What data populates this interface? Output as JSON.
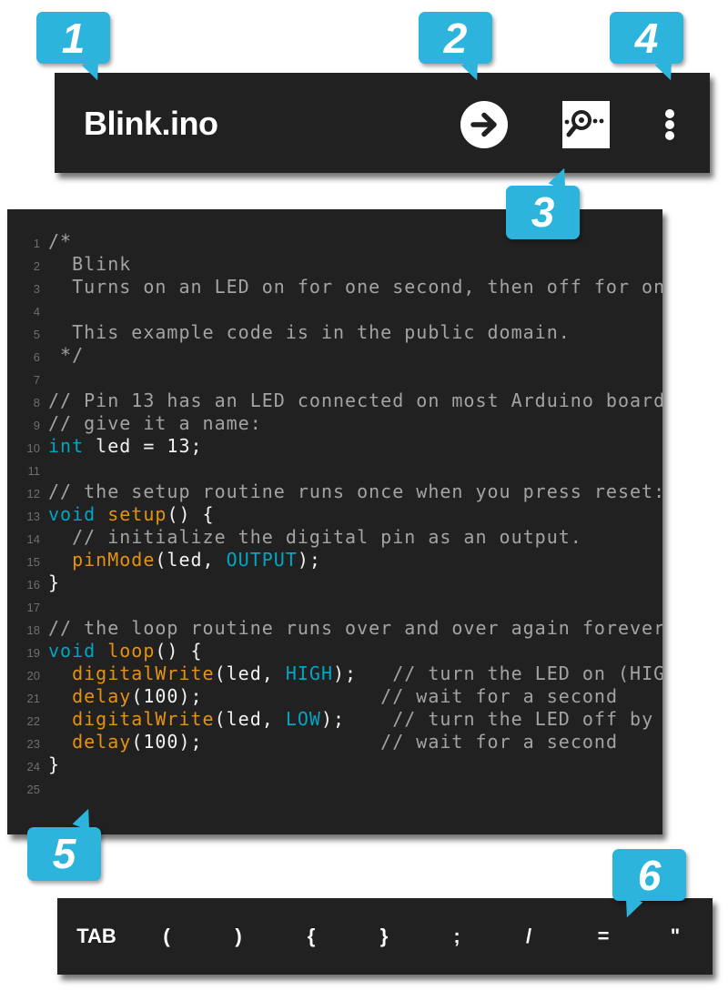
{
  "app_bar": {
    "title": "Blink.ino",
    "upload_icon": "arrow-right-circle-icon",
    "serial_monitor_icon": "serial-monitor-magnifier-icon",
    "overflow_icon": "more-vert-icon"
  },
  "editor": {
    "lines": [
      {
        "num": "1",
        "tokens": [
          {
            "t": "/*",
            "c": "comment"
          }
        ]
      },
      {
        "num": "2",
        "tokens": [
          {
            "t": "  Blink",
            "c": "comment"
          }
        ]
      },
      {
        "num": "3",
        "tokens": [
          {
            "t": "  Turns on an LED on for one second, then off for on",
            "c": "comment"
          }
        ]
      },
      {
        "num": "4",
        "tokens": []
      },
      {
        "num": "5",
        "tokens": [
          {
            "t": "  This example code is in the public domain.",
            "c": "comment"
          }
        ]
      },
      {
        "num": "6",
        "tokens": [
          {
            "t": " */",
            "c": "comment"
          }
        ]
      },
      {
        "num": "7",
        "tokens": []
      },
      {
        "num": "8",
        "tokens": [
          {
            "t": "// Pin 13 has an LED connected on most Arduino board",
            "c": "comment"
          }
        ]
      },
      {
        "num": "9",
        "tokens": [
          {
            "t": "// give it a name:",
            "c": "comment"
          }
        ]
      },
      {
        "num": "10",
        "tokens": [
          {
            "t": "int",
            "c": "type"
          },
          {
            "t": " led = 13;",
            "c": "plain"
          }
        ]
      },
      {
        "num": "11",
        "tokens": []
      },
      {
        "num": "12",
        "tokens": [
          {
            "t": "// the setup routine runs once when you press reset:",
            "c": "comment"
          }
        ]
      },
      {
        "num": "13",
        "tokens": [
          {
            "t": "void",
            "c": "type"
          },
          {
            "t": " ",
            "c": "plain"
          },
          {
            "t": "setup",
            "c": "func"
          },
          {
            "t": "() {",
            "c": "plain"
          }
        ]
      },
      {
        "num": "14",
        "tokens": [
          {
            "t": "  // initialize the digital pin as an output.",
            "c": "comment"
          }
        ]
      },
      {
        "num": "15",
        "tokens": [
          {
            "t": "  ",
            "c": "plain"
          },
          {
            "t": "pinMode",
            "c": "func"
          },
          {
            "t": "(led, ",
            "c": "plain"
          },
          {
            "t": "OUTPUT",
            "c": "const"
          },
          {
            "t": ");",
            "c": "plain"
          }
        ]
      },
      {
        "num": "16",
        "tokens": [
          {
            "t": "}",
            "c": "plain"
          }
        ]
      },
      {
        "num": "17",
        "tokens": []
      },
      {
        "num": "18",
        "tokens": [
          {
            "t": "// the loop routine runs over and over again forever",
            "c": "comment"
          }
        ]
      },
      {
        "num": "19",
        "tokens": [
          {
            "t": "void",
            "c": "type"
          },
          {
            "t": " ",
            "c": "plain"
          },
          {
            "t": "loop",
            "c": "func"
          },
          {
            "t": "() {",
            "c": "plain"
          }
        ]
      },
      {
        "num": "20",
        "tokens": [
          {
            "t": "  ",
            "c": "plain"
          },
          {
            "t": "digitalWrite",
            "c": "func"
          },
          {
            "t": "(led, ",
            "c": "plain"
          },
          {
            "t": "HIGH",
            "c": "const"
          },
          {
            "t": ");",
            "c": "plain"
          },
          {
            "t": "   // turn the LED on (HIG",
            "c": "comment"
          }
        ]
      },
      {
        "num": "21",
        "tokens": [
          {
            "t": "  ",
            "c": "plain"
          },
          {
            "t": "delay",
            "c": "func"
          },
          {
            "t": "(100);",
            "c": "plain"
          },
          {
            "t": "               // wait for a second",
            "c": "comment"
          }
        ]
      },
      {
        "num": "22",
        "tokens": [
          {
            "t": "  ",
            "c": "plain"
          },
          {
            "t": "digitalWrite",
            "c": "func"
          },
          {
            "t": "(led, ",
            "c": "plain"
          },
          {
            "t": "LOW",
            "c": "const"
          },
          {
            "t": ");",
            "c": "plain"
          },
          {
            "t": "    // turn the LED off by",
            "c": "comment"
          }
        ]
      },
      {
        "num": "23",
        "tokens": [
          {
            "t": "  ",
            "c": "plain"
          },
          {
            "t": "delay",
            "c": "func"
          },
          {
            "t": "(100);",
            "c": "plain"
          },
          {
            "t": "               // wait for a second",
            "c": "comment"
          }
        ]
      },
      {
        "num": "24",
        "tokens": [
          {
            "t": "}",
            "c": "plain"
          }
        ]
      },
      {
        "num": "25",
        "tokens": []
      }
    ]
  },
  "symbol_bar": {
    "keys": [
      "TAB",
      "(",
      ")",
      "{",
      "}",
      ";",
      "/",
      "=",
      "\""
    ]
  },
  "callouts": [
    "1",
    "2",
    "3",
    "4",
    "5",
    "6"
  ],
  "colors": {
    "background_dark": "#212121",
    "callout_blue": "#2db4dc",
    "syntax_type": "#00a6c4",
    "syntax_function": "#e6920f",
    "syntax_comment": "#a3a3a3",
    "syntax_plain": "#f2f2f2"
  }
}
